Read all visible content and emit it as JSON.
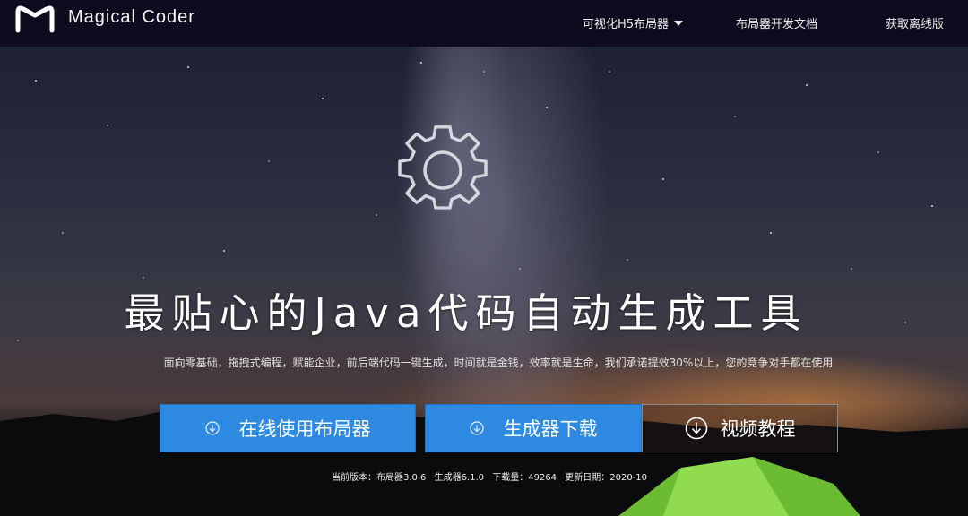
{
  "header": {
    "brand": "Magical Coder",
    "nav": [
      {
        "label": "可视化H5布局器",
        "has_dropdown": true
      },
      {
        "label": "布局器开发文档"
      },
      {
        "label": "获取离线版"
      }
    ]
  },
  "hero": {
    "icon": "gear-icon",
    "headline": "最贴心的Java代码自动生成工具",
    "subline": "面向零基础，拖拽式编程，赋能企业，前后端代码一键生成，时间就是金钱，效率就是生命，我们承诺提效30%以上，您的竞争对手都在使用",
    "buttons": [
      {
        "label": "在线使用布局器",
        "icon": "download-icon"
      },
      {
        "label": "生成器下载",
        "icon": "download-icon"
      },
      {
        "label": "视频教程",
        "icon": "download-icon"
      }
    ],
    "meta": {
      "version": "当前版本：布局器3.0.6",
      "generator": "生成器6.1.0",
      "downloads": "下载量：49264",
      "updated": "更新日期：2020-10"
    }
  },
  "colors": {
    "topbar": "#0f0b1e",
    "button_blue": "#2d8ae0",
    "text": "#ffffff"
  }
}
